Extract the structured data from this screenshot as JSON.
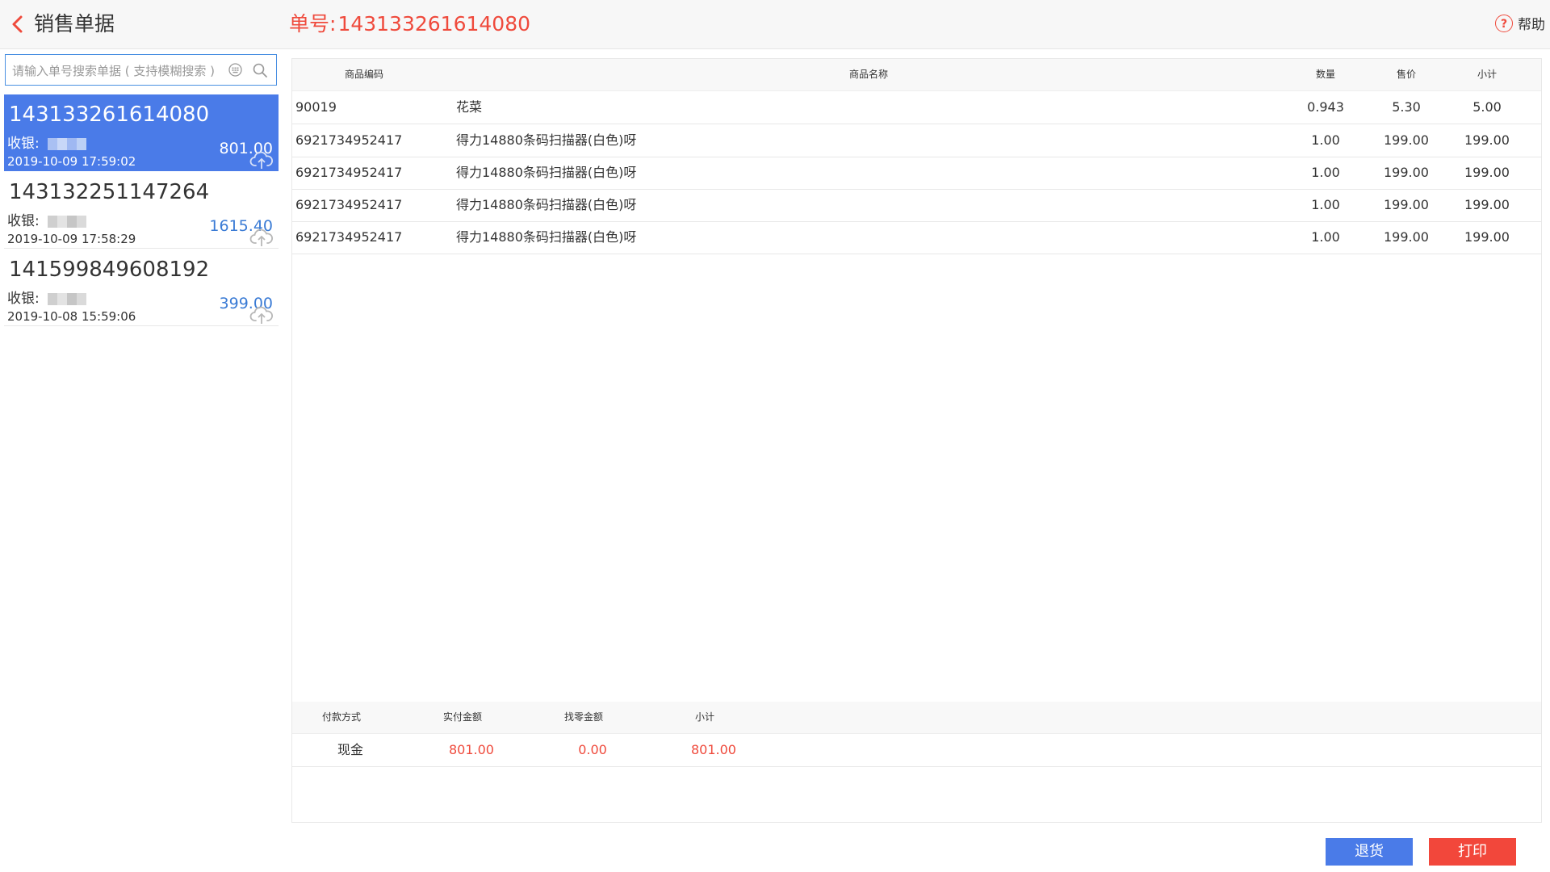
{
  "header": {
    "title": "销售单据",
    "order_label": "单号:",
    "order_no": "143133261614080",
    "help_label": "帮助"
  },
  "search": {
    "placeholder": "请输入单号搜索单据 ( 支持模糊搜索 )",
    "value": ""
  },
  "receipts": [
    {
      "no": "143133261614080",
      "cashier_label": "收银:",
      "amount": "801.00",
      "time": "2019-10-09 17:59:02",
      "active": true
    },
    {
      "no": "143132251147264",
      "cashier_label": "收银:",
      "amount": "1615.40",
      "time": "2019-10-09 17:58:29",
      "active": false
    },
    {
      "no": "141599849608192",
      "cashier_label": "收银:",
      "amount": "399.00",
      "time": "2019-10-08 15:59:06",
      "active": false
    }
  ],
  "items_table": {
    "headers": {
      "code": "商品编码",
      "name": "商品名称",
      "qty": "数量",
      "price": "售价",
      "subtotal": "小计"
    },
    "rows": [
      {
        "code": "90019",
        "name": "花菜",
        "qty": "0.943",
        "price": "5.30",
        "subtotal": "5.00"
      },
      {
        "code": "6921734952417",
        "name": "得力14880条码扫描器(白色)呀",
        "qty": "1.00",
        "price": "199.00",
        "subtotal": "199.00"
      },
      {
        "code": "6921734952417",
        "name": "得力14880条码扫描器(白色)呀",
        "qty": "1.00",
        "price": "199.00",
        "subtotal": "199.00"
      },
      {
        "code": "6921734952417",
        "name": "得力14880条码扫描器(白色)呀",
        "qty": "1.00",
        "price": "199.00",
        "subtotal": "199.00"
      },
      {
        "code": "6921734952417",
        "name": "得力14880条码扫描器(白色)呀",
        "qty": "1.00",
        "price": "199.00",
        "subtotal": "199.00"
      }
    ]
  },
  "payment_table": {
    "headers": {
      "method": "付款方式",
      "paid": "实付金额",
      "change": "找零金额",
      "subtotal": "小计"
    },
    "rows": [
      {
        "method": "现金",
        "paid": "801.00",
        "change": "0.00",
        "subtotal": "801.00"
      }
    ]
  },
  "buttons": {
    "return_label": "退货",
    "print_label": "打印"
  },
  "colors": {
    "accent_blue": "#4a7be8",
    "accent_red": "#ef4a3c",
    "amount_blue": "#3a7bd5"
  }
}
